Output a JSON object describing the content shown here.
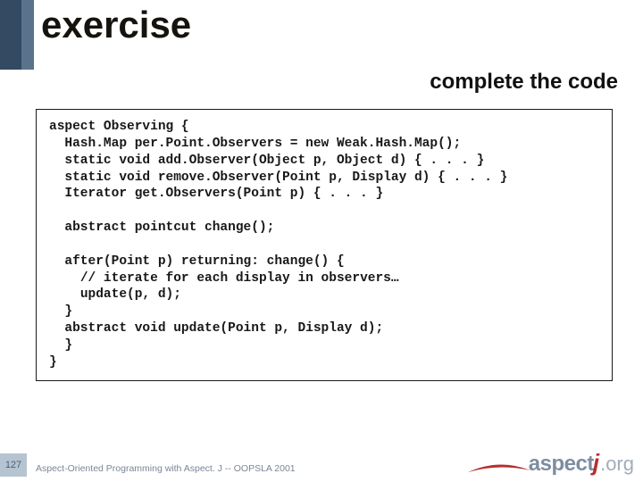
{
  "title": "exercise",
  "subtitle": "complete the code",
  "code": "aspect Observing {\n  Hash.Map per.Point.Observers = new Weak.Hash.Map();\n  static void add.Observer(Object p, Object d) { . . . }\n  static void remove.Observer(Point p, Display d) { . . . }\n  Iterator get.Observers(Point p) { . . . }\n\n  abstract pointcut change();\n\n  after(Point p) returning: change() {\n    // iterate for each display in observers…\n    update(p, d);\n  }\n  abstract void update(Point p, Display d);\n  }\n}",
  "slide_number": "127",
  "footer": "Aspect-Oriented Programming with Aspect. J -- OOPSLA 2001",
  "logo": {
    "pre": "aspect",
    "em": "j",
    "post": ".org"
  }
}
